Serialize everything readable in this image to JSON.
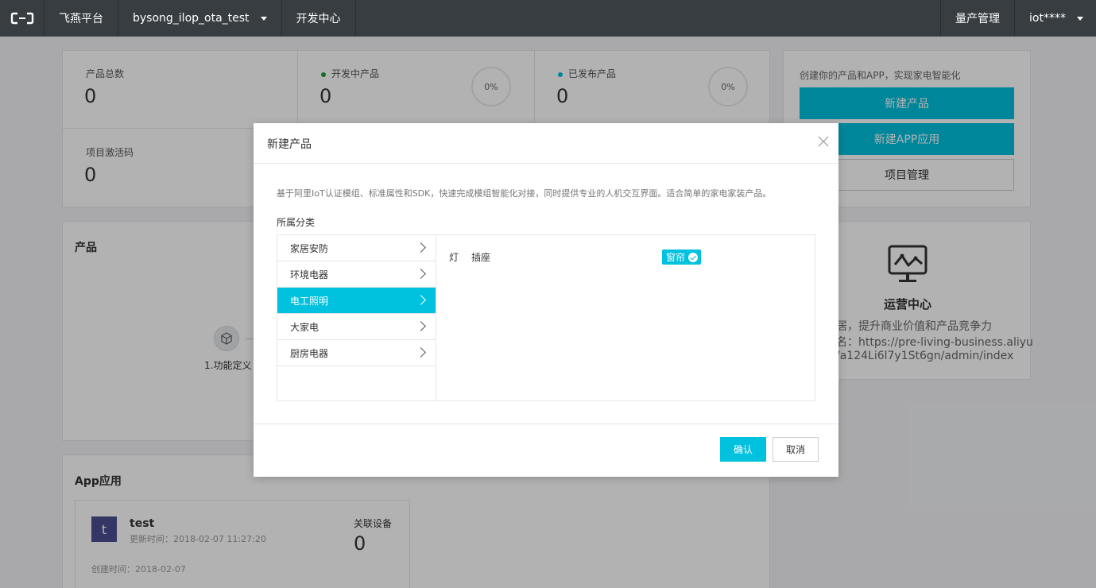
{
  "topbar": {
    "platform": "飞燕平台",
    "project": "bysong_ilop_ota_test",
    "dev_center": "开发中心",
    "mass_production": "量产管理",
    "user": "iot****"
  },
  "stats": {
    "total_label": "产品总数",
    "total_value": "0",
    "dev_label": "开发中产品",
    "dev_value": "0",
    "dev_percent": "0%",
    "released_label": "已发布产品",
    "released_value": "0",
    "released_percent": "0%",
    "activation_label": "项目激活码",
    "activation_value": "0"
  },
  "actions": {
    "tagline": "创建你的产品和APP，实现家电智能化",
    "new_product": "新建产品",
    "new_app": "新建APP应用",
    "project_manage": "项目管理"
  },
  "product_section": {
    "title": "产品",
    "step1": "1.功能定义"
  },
  "ops_center": {
    "title": "运营中心",
    "line1": "居，提升商业价值和产品竞争力",
    "line2": "名：https://pre-living-business.aliyu",
    "line3": "/a124Li6l7y1St6gn/admin/index"
  },
  "app_section": {
    "title": "App应用",
    "app": {
      "avatar": "t",
      "name": "test",
      "updated": "更新时间：2018-02-07 11:27:20",
      "linked_label": "关联设备",
      "linked_value": "0",
      "created": "创建时间：2018-02-07"
    }
  },
  "modal": {
    "title": "新建产品",
    "description": "基于阿里IoT认证模组、标准属性和SDK，快速完成模组智能化对接，同时提供专业的人机交互界面。适合简单的家电家装产品。",
    "category_label": "所属分类",
    "categories": [
      {
        "label": "家居安防"
      },
      {
        "label": "环境电器"
      },
      {
        "label": "电工照明"
      },
      {
        "label": "大家电"
      },
      {
        "label": "厨房电器"
      }
    ],
    "subcategories": [
      {
        "label": "灯"
      },
      {
        "label": "插座"
      },
      {
        "label": "窗帘"
      }
    ],
    "confirm": "确认",
    "cancel": "取消"
  },
  "colors": {
    "accent": "#00c1de",
    "topbar": "#373d41",
    "dev_dot": "#1e9e2f",
    "released_dot": "#00c1de"
  }
}
